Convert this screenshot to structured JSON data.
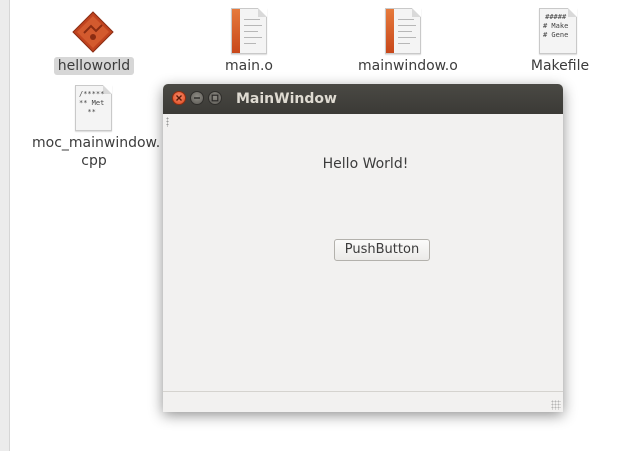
{
  "desktop": {
    "icons": [
      {
        "label": "helloworld",
        "type": "executable"
      },
      {
        "label": "main.o",
        "type": "object-file"
      },
      {
        "label": "mainwindow.o",
        "type": "object-file"
      },
      {
        "label": "Makefile",
        "type": "text-file",
        "preview": "#####\n# Make\n# Gene"
      },
      {
        "label_line1": "moc_mainwindow.",
        "label_line2": "cpp",
        "type": "cpp-source",
        "preview": "/*****\n** Met\n**"
      }
    ]
  },
  "window": {
    "title": "MainWindow",
    "hello_label": "Hello World!",
    "push_button_label": "PushButton"
  },
  "colors": {
    "titlebar": "#3c3b37",
    "close_button": "#e35a2c",
    "window_bg": "#f2f1f0",
    "executable_icon": "#c0431f"
  }
}
